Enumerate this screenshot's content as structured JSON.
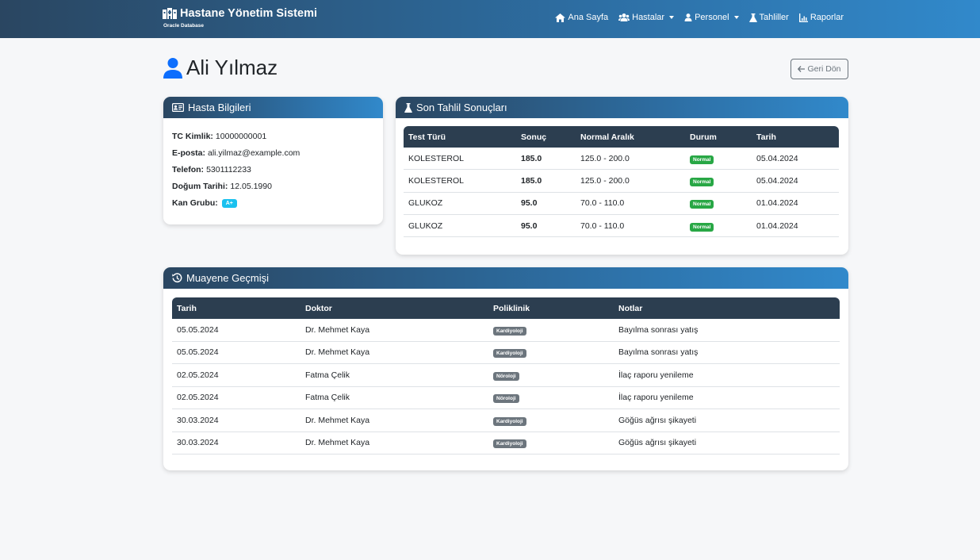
{
  "navbar": {
    "brand_title": "Hastane Yönetim Sistemi",
    "brand_subtitle": "Oracle Database",
    "items": [
      {
        "label": "Ana Sayfa",
        "icon": "home-icon"
      },
      {
        "label": "Hastalar",
        "icon": "users-icon",
        "dropdown": true
      },
      {
        "label": "Personel",
        "icon": "user-icon",
        "dropdown": true
      },
      {
        "label": "Tahliller",
        "icon": "flask-icon"
      },
      {
        "label": "Raporlar",
        "icon": "chart-icon"
      }
    ]
  },
  "page": {
    "title": "Ali Yılmaz",
    "back_label": "Geri Dön"
  },
  "patient_info": {
    "header": "Hasta Bilgileri",
    "tc_label": "TC Kimlik:",
    "tc_value": "10000000001",
    "email_label": "E-posta:",
    "email_value": "ali.yilmaz@example.com",
    "phone_label": "Telefon:",
    "phone_value": "5301112233",
    "birth_label": "Doğum Tarihi:",
    "birth_value": "12.05.1990",
    "blood_label": "Kan Grubu:",
    "blood_value": "A+"
  },
  "lab_results": {
    "header": "Son Tahlil Sonuçları",
    "columns": [
      "Test Türü",
      "Sonuç",
      "Normal Aralık",
      "Durum",
      "Tarih"
    ],
    "rows": [
      {
        "test": "KOLESTEROL",
        "result": "185.0",
        "range": "125.0 - 200.0",
        "status": "Normal",
        "date": "05.04.2024"
      },
      {
        "test": "KOLESTEROL",
        "result": "185.0",
        "range": "125.0 - 200.0",
        "status": "Normal",
        "date": "05.04.2024"
      },
      {
        "test": "GLUKOZ",
        "result": "95.0",
        "range": "70.0 - 110.0",
        "status": "Normal",
        "date": "01.04.2024"
      },
      {
        "test": "GLUKOZ",
        "result": "95.0",
        "range": "70.0 - 110.0",
        "status": "Normal",
        "date": "01.04.2024"
      }
    ]
  },
  "exam_history": {
    "header": "Muayene Geçmişi",
    "columns": [
      "Tarih",
      "Doktor",
      "Poliklinik",
      "Notlar"
    ],
    "rows": [
      {
        "date": "05.05.2024",
        "doctor": "Dr. Mehmet Kaya",
        "clinic": "Kardiyoloji",
        "notes": "Bayılma sonrası yatış"
      },
      {
        "date": "05.05.2024",
        "doctor": "Dr. Mehmet Kaya",
        "clinic": "Kardiyoloji",
        "notes": "Bayılma sonrası yatış"
      },
      {
        "date": "02.05.2024",
        "doctor": "Fatma Çelik",
        "clinic": "Nöroloji",
        "notes": "İlaç raporu yenileme"
      },
      {
        "date": "02.05.2024",
        "doctor": "Fatma Çelik",
        "clinic": "Nöroloji",
        "notes": "İlaç raporu yenileme"
      },
      {
        "date": "30.03.2024",
        "doctor": "Dr. Mehmet Kaya",
        "clinic": "Kardiyoloji",
        "notes": "Göğüs ağrısı şikayeti"
      },
      {
        "date": "30.03.2024",
        "doctor": "Dr. Mehmet Kaya",
        "clinic": "Kardiyoloji",
        "notes": "Göğüs ağrısı şikayeti"
      }
    ]
  },
  "colors": {
    "nav_gradient_start": "#2a4661",
    "nav_gradient_end": "#3189cb",
    "table_header": "#2c3e50",
    "status_normal": "#28a745",
    "clinic_badge": "#6c757d",
    "blood_badge": "#1ac1ef",
    "user_icon": "#0d6efd"
  }
}
